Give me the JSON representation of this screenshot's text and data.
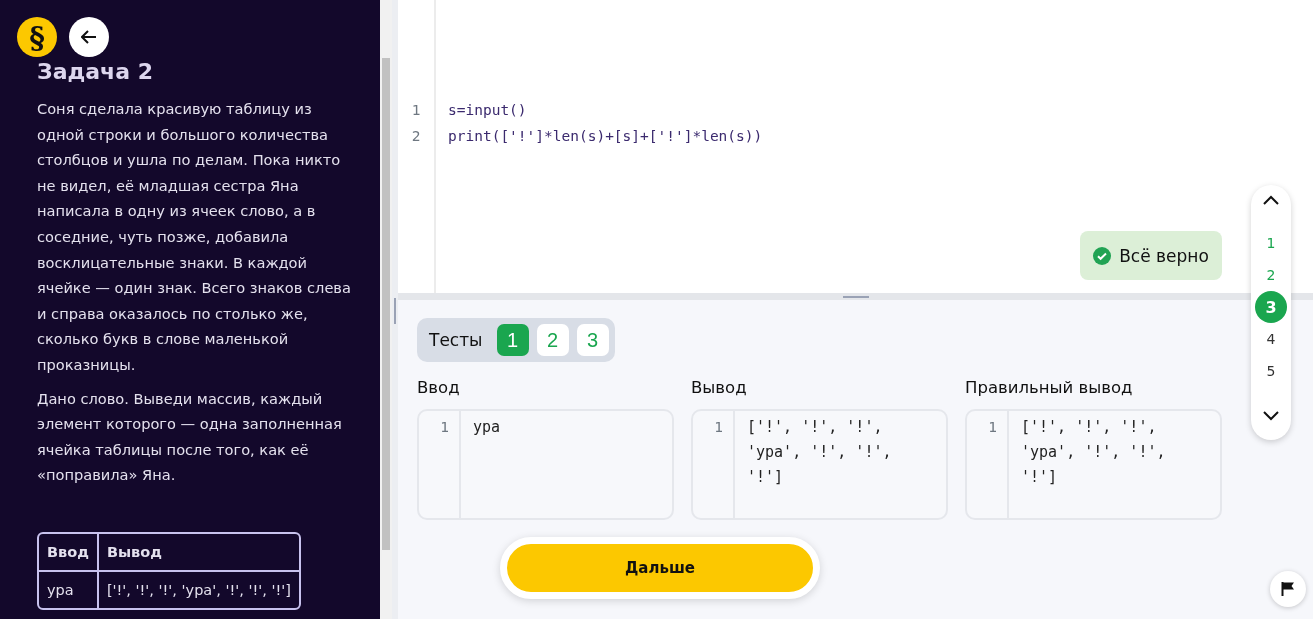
{
  "logo": {
    "glyph": "§"
  },
  "task": {
    "title": "Задача 2",
    "paragraphs": [
      "Соня сделала красивую таблицу из одной строки и большого количества столбцов и ушла по делам. Пока никто не видел, её младшая сестра Яна написала в одну из ячеек слово, а в соседние, чуть позже, добавила восклицательные знаки. В каждой ячейке — один знак. Всего знаков слева и справа оказалось по столько же, сколько букв в слове маленькой проказницы.",
      "Дано слово. Выведи массив, каждый элемент которого — одна заполненная ячейка таблицы после того, как её «поправила» Яна."
    ],
    "example": {
      "columns": [
        "Ввод",
        "Вывод"
      ],
      "rows": [
        [
          "ура",
          "['!', '!', '!', 'ура', '!', '!', '!']"
        ]
      ]
    }
  },
  "editor": {
    "lines": [
      {
        "number": "1",
        "code": "s=input()"
      },
      {
        "number": "2",
        "code": "print(['!']*len(s)+[s]+['!']*len(s))"
      }
    ]
  },
  "status": {
    "text": "Всё верно"
  },
  "tests": {
    "label": "Тесты",
    "tabs": [
      {
        "label": "1",
        "selected": true
      },
      {
        "label": "2",
        "selected": false
      },
      {
        "label": "3",
        "selected": false
      }
    ]
  },
  "panels": [
    {
      "title": "Ввод",
      "lines": [
        {
          "number": "1",
          "text": "ура"
        }
      ]
    },
    {
      "title": "Вывод",
      "lines": [
        {
          "number": "1",
          "text": "['!', '!', '!', 'ура', '!', '!', '!']"
        }
      ]
    },
    {
      "title": "Правильный вывод",
      "lines": [
        {
          "number": "1",
          "text": "['!', '!', '!', 'ура', '!', '!', '!']"
        }
      ]
    }
  ],
  "next_button": "Дальше",
  "task_nav": {
    "items": [
      {
        "label": "1",
        "solved": true,
        "selected": false
      },
      {
        "label": "2",
        "solved": true,
        "selected": false
      },
      {
        "label": "3",
        "solved": true,
        "selected": true
      },
      {
        "label": "4",
        "solved": false,
        "selected": false
      },
      {
        "label": "5",
        "solved": false,
        "selected": false
      }
    ]
  }
}
